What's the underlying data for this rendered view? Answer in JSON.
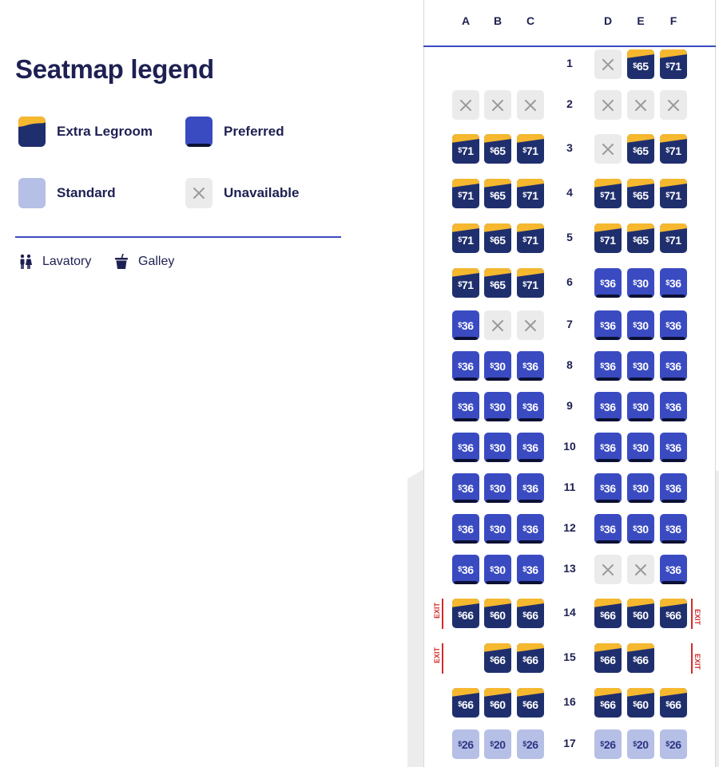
{
  "legend": {
    "title": "Seatmap legend",
    "items": [
      {
        "key": "extra",
        "label": "Extra Legroom"
      },
      {
        "key": "pref",
        "label": "Preferred"
      },
      {
        "key": "std",
        "label": "Standard"
      },
      {
        "key": "unavail",
        "label": "Unavailable"
      }
    ],
    "amenities": {
      "lavatory": "Lavatory",
      "galley": "Galley"
    }
  },
  "colors": {
    "extra_legroom": "#1f2f6e",
    "extra_legroom_accent": "#f6b82f",
    "preferred": "#3a4bc2",
    "standard": "#b6bfe6",
    "unavailable": "#ebebeb",
    "exit": "#d42a2a",
    "divider": "#3b4ac0"
  },
  "seatmap": {
    "columns_left": [
      "A",
      "B",
      "C"
    ],
    "columns_right": [
      "D",
      "E",
      "F"
    ],
    "currency_symbol": "$",
    "exit_label": "EXIT",
    "rows": [
      {
        "number": "1",
        "left": [
          null,
          null,
          null
        ],
        "right": [
          {
            "type": "unavail"
          },
          {
            "type": "extra",
            "price": "65"
          },
          {
            "type": "extra",
            "price": "71"
          }
        ]
      },
      {
        "number": "2",
        "left": [
          {
            "type": "unavail"
          },
          {
            "type": "unavail"
          },
          {
            "type": "unavail"
          }
        ],
        "right": [
          {
            "type": "unavail"
          },
          {
            "type": "unavail"
          },
          {
            "type": "unavail"
          }
        ]
      },
      {
        "number": "3",
        "left": [
          {
            "type": "extra",
            "price": "71"
          },
          {
            "type": "extra",
            "price": "65"
          },
          {
            "type": "extra",
            "price": "71"
          }
        ],
        "right": [
          {
            "type": "unavail"
          },
          {
            "type": "extra",
            "price": "65"
          },
          {
            "type": "extra",
            "price": "71"
          }
        ]
      },
      {
        "number": "4",
        "left": [
          {
            "type": "extra",
            "price": "71"
          },
          {
            "type": "extra",
            "price": "65"
          },
          {
            "type": "extra",
            "price": "71"
          }
        ],
        "right": [
          {
            "type": "extra",
            "price": "71"
          },
          {
            "type": "extra",
            "price": "65"
          },
          {
            "type": "extra",
            "price": "71"
          }
        ]
      },
      {
        "number": "5",
        "left": [
          {
            "type": "extra",
            "price": "71"
          },
          {
            "type": "extra",
            "price": "65"
          },
          {
            "type": "extra",
            "price": "71"
          }
        ],
        "right": [
          {
            "type": "extra",
            "price": "71"
          },
          {
            "type": "extra",
            "price": "65"
          },
          {
            "type": "extra",
            "price": "71"
          }
        ]
      },
      {
        "number": "6",
        "left": [
          {
            "type": "extra",
            "price": "71"
          },
          {
            "type": "extra",
            "price": "65"
          },
          {
            "type": "extra",
            "price": "71"
          }
        ],
        "right": [
          {
            "type": "pref",
            "price": "36"
          },
          {
            "type": "pref",
            "price": "30"
          },
          {
            "type": "pref",
            "price": "36"
          }
        ]
      },
      {
        "number": "7",
        "left": [
          {
            "type": "pref",
            "price": "36"
          },
          {
            "type": "unavail"
          },
          {
            "type": "unavail"
          }
        ],
        "right": [
          {
            "type": "pref",
            "price": "36"
          },
          {
            "type": "pref",
            "price": "30"
          },
          {
            "type": "pref",
            "price": "36"
          }
        ]
      },
      {
        "number": "8",
        "left": [
          {
            "type": "pref",
            "price": "36"
          },
          {
            "type": "pref",
            "price": "30"
          },
          {
            "type": "pref",
            "price": "36"
          }
        ],
        "right": [
          {
            "type": "pref",
            "price": "36"
          },
          {
            "type": "pref",
            "price": "30"
          },
          {
            "type": "pref",
            "price": "36"
          }
        ]
      },
      {
        "number": "9",
        "left": [
          {
            "type": "pref",
            "price": "36"
          },
          {
            "type": "pref",
            "price": "30"
          },
          {
            "type": "pref",
            "price": "36"
          }
        ],
        "right": [
          {
            "type": "pref",
            "price": "36"
          },
          {
            "type": "pref",
            "price": "30"
          },
          {
            "type": "pref",
            "price": "36"
          }
        ]
      },
      {
        "number": "10",
        "left": [
          {
            "type": "pref",
            "price": "36"
          },
          {
            "type": "pref",
            "price": "30"
          },
          {
            "type": "pref",
            "price": "36"
          }
        ],
        "right": [
          {
            "type": "pref",
            "price": "36"
          },
          {
            "type": "pref",
            "price": "30"
          },
          {
            "type": "pref",
            "price": "36"
          }
        ]
      },
      {
        "number": "11",
        "left": [
          {
            "type": "pref",
            "price": "36"
          },
          {
            "type": "pref",
            "price": "30"
          },
          {
            "type": "pref",
            "price": "36"
          }
        ],
        "right": [
          {
            "type": "pref",
            "price": "36"
          },
          {
            "type": "pref",
            "price": "30"
          },
          {
            "type": "pref",
            "price": "36"
          }
        ]
      },
      {
        "number": "12",
        "left": [
          {
            "type": "pref",
            "price": "36"
          },
          {
            "type": "pref",
            "price": "30"
          },
          {
            "type": "pref",
            "price": "36"
          }
        ],
        "right": [
          {
            "type": "pref",
            "price": "36"
          },
          {
            "type": "pref",
            "price": "30"
          },
          {
            "type": "pref",
            "price": "36"
          }
        ]
      },
      {
        "number": "13",
        "left": [
          {
            "type": "pref",
            "price": "36"
          },
          {
            "type": "pref",
            "price": "30"
          },
          {
            "type": "pref",
            "price": "36"
          }
        ],
        "right": [
          {
            "type": "unavail"
          },
          {
            "type": "unavail"
          },
          {
            "type": "pref",
            "price": "36"
          }
        ]
      },
      {
        "number": "14",
        "exit": true,
        "left": [
          {
            "type": "extra",
            "price": "66"
          },
          {
            "type": "extra",
            "price": "60"
          },
          {
            "type": "extra",
            "price": "66"
          }
        ],
        "right": [
          {
            "type": "extra",
            "price": "66"
          },
          {
            "type": "extra",
            "price": "60"
          },
          {
            "type": "extra",
            "price": "66"
          }
        ]
      },
      {
        "number": "15",
        "exit": true,
        "left": [
          null,
          {
            "type": "extra",
            "price": "66"
          },
          {
            "type": "extra",
            "price": "66"
          }
        ],
        "right": [
          {
            "type": "extra",
            "price": "66"
          },
          {
            "type": "extra",
            "price": "66"
          },
          null
        ]
      },
      {
        "number": "16",
        "left": [
          {
            "type": "extra",
            "price": "66"
          },
          {
            "type": "extra",
            "price": "60"
          },
          {
            "type": "extra",
            "price": "66"
          }
        ],
        "right": [
          {
            "type": "extra",
            "price": "66"
          },
          {
            "type": "extra",
            "price": "60"
          },
          {
            "type": "extra",
            "price": "66"
          }
        ]
      },
      {
        "number": "17",
        "left": [
          {
            "type": "std",
            "price": "26"
          },
          {
            "type": "std",
            "price": "20"
          },
          {
            "type": "std",
            "price": "26"
          }
        ],
        "right": [
          {
            "type": "std",
            "price": "26"
          },
          {
            "type": "std",
            "price": "20"
          },
          {
            "type": "std",
            "price": "26"
          }
        ]
      }
    ]
  }
}
